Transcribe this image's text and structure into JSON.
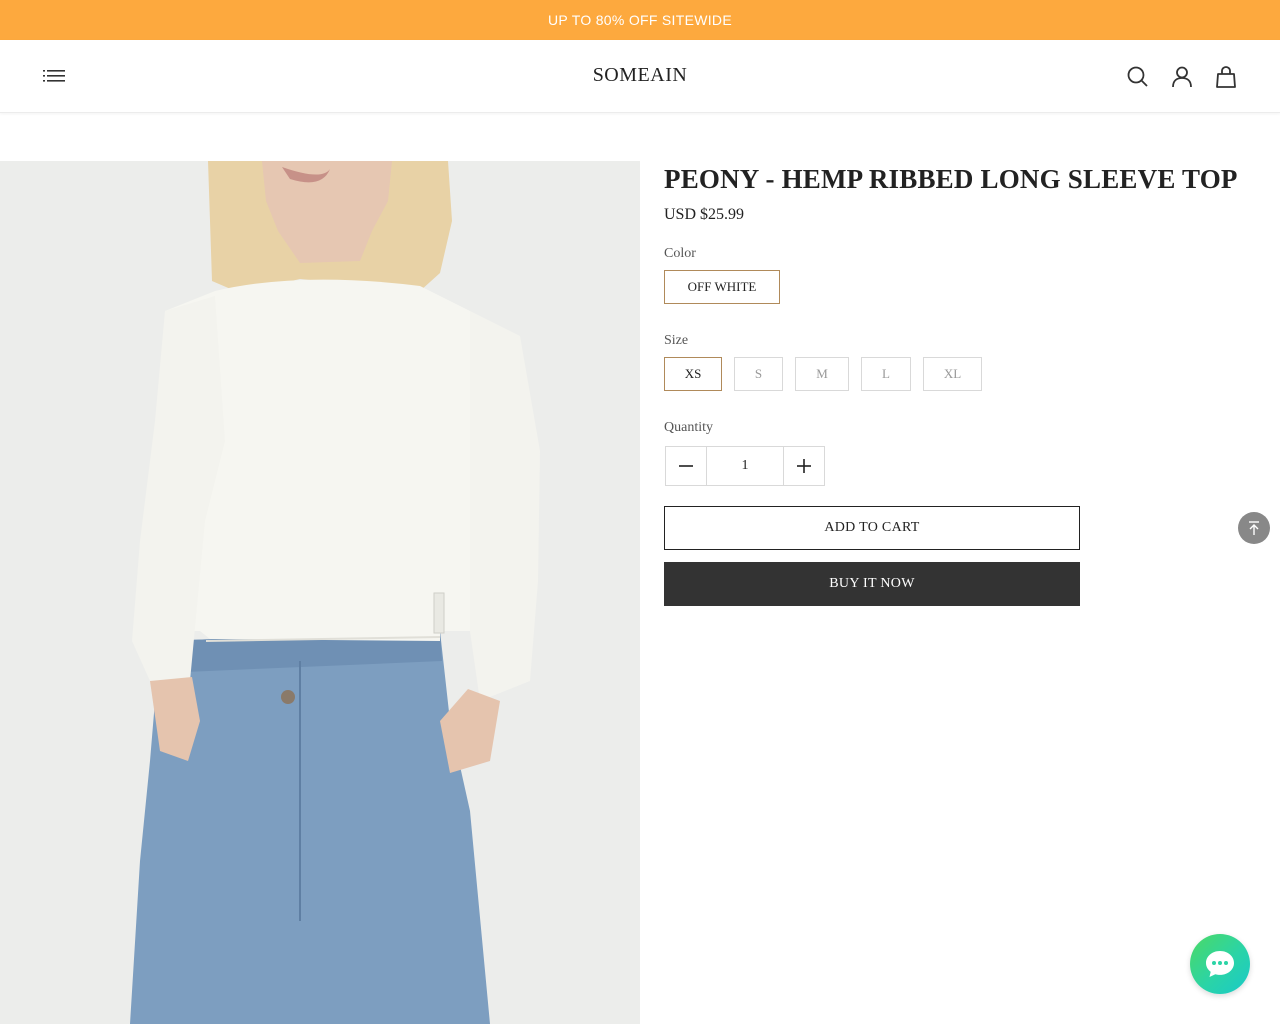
{
  "promo": {
    "text": "UP TO 80% OFF SITEWIDE"
  },
  "header": {
    "logo": "SOMEAIN",
    "icons": [
      "menu-icon",
      "search-icon",
      "account-icon",
      "cart-icon"
    ]
  },
  "product": {
    "title": "PEONY - HEMP RIBBED LONG SLEEVE TOP",
    "price": "USD $25.99",
    "color": {
      "label": "Color",
      "options": [
        {
          "label": "OFF WHITE",
          "selected": true
        }
      ]
    },
    "size": {
      "label": "Size",
      "options": [
        {
          "label": "XS",
          "selected": true
        },
        {
          "label": "S",
          "selected": false
        },
        {
          "label": "M",
          "selected": false
        },
        {
          "label": "L",
          "selected": false
        },
        {
          "label": "XL",
          "selected": false
        }
      ]
    },
    "quantity": {
      "label": "Quantity",
      "value": "1"
    },
    "add_to_cart": "ADD TO CART",
    "buy_now": "BUY IT NOW"
  },
  "colors": {
    "promo_bg": "#fda93e",
    "selected_border": "#b08a5a",
    "buy_now_bg": "#333333",
    "chat_gradient": [
      "#4cd964",
      "#19c9c9"
    ]
  },
  "floating": {
    "icons": [
      "arrow-up-icon",
      "chat-bubble-icon"
    ]
  }
}
